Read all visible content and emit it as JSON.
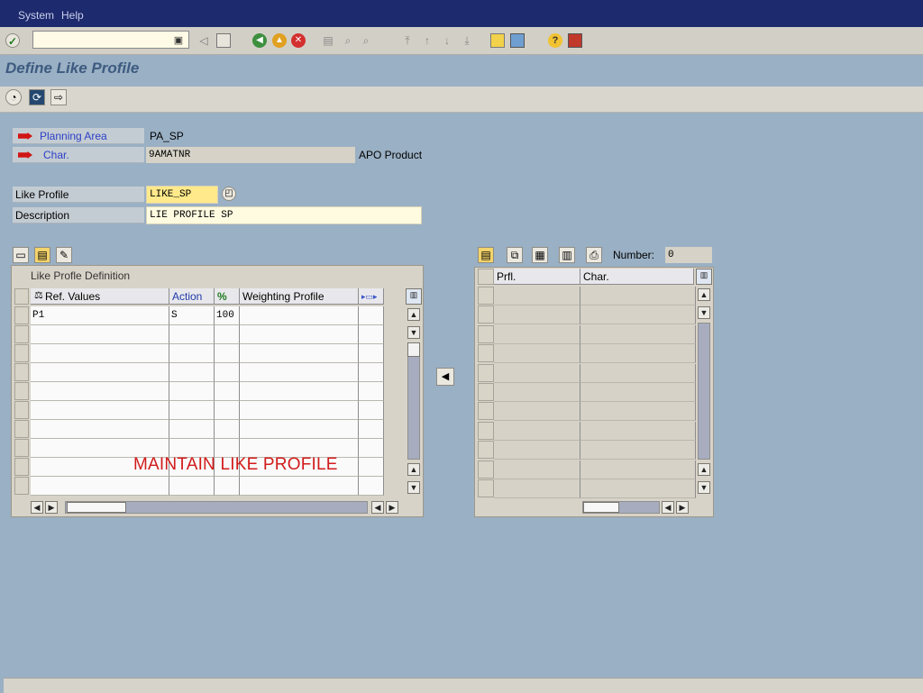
{
  "menu": {
    "system": "System",
    "help": "Help"
  },
  "page": {
    "title": "Define Like Profile"
  },
  "header": {
    "planning_area_label": "Planning Area",
    "planning_area_value": "PA_SP",
    "char_label": "Char.",
    "char_value": "9AMATNR",
    "char_desc": "APO Product"
  },
  "form": {
    "like_profile_label": "Like Profile",
    "like_profile_value": "LIKE_SP",
    "description_label": "Description",
    "description_value": "LIE PROFILE SP"
  },
  "left_table": {
    "title": "Like Profle Definition",
    "columns": [
      "Ref. Values",
      "Action",
      "",
      "Weighting Profile",
      ""
    ],
    "rows": [
      [
        "P1",
        "S",
        "100",
        "",
        ""
      ],
      [
        "",
        "",
        "",
        "",
        ""
      ],
      [
        "",
        "",
        "",
        "",
        ""
      ],
      [
        "",
        "",
        "",
        "",
        ""
      ],
      [
        "",
        "",
        "",
        "",
        ""
      ],
      [
        "",
        "",
        "",
        "",
        ""
      ],
      [
        "",
        "",
        "",
        "",
        ""
      ],
      [
        "",
        "",
        "",
        "",
        ""
      ],
      [
        "",
        "",
        "",
        "",
        ""
      ],
      [
        "",
        "",
        "",
        "",
        ""
      ]
    ]
  },
  "right_table": {
    "number_label": "Number:",
    "number_value": "0",
    "columns": [
      "Prfl.",
      "Char."
    ],
    "rows": [
      [
        "",
        ""
      ],
      [
        "",
        ""
      ],
      [
        "",
        ""
      ],
      [
        "",
        ""
      ],
      [
        "",
        ""
      ],
      [
        "",
        ""
      ],
      [
        "",
        ""
      ],
      [
        "",
        ""
      ],
      [
        "",
        ""
      ],
      [
        "",
        ""
      ],
      [
        "",
        ""
      ]
    ]
  },
  "overlay_text": "MAINTAIN LIKE PROFILE",
  "colors": {
    "menubar": "#1e2a6e",
    "background": "#9ab0c4",
    "title": "#3d5b80",
    "overlay": "#d21b1b",
    "marker": "#d11515"
  }
}
